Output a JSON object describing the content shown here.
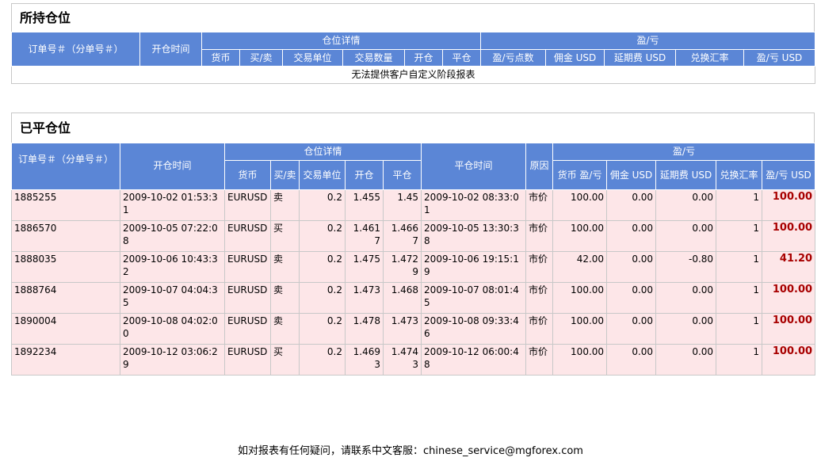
{
  "open_positions": {
    "title": "所持仓位",
    "headers": {
      "order": "订单号＃（分单号＃）",
      "open_time": "开仓时间",
      "details": "仓位详情",
      "pl": "盈/亏",
      "currency": "货币",
      "buy_sell": "买/卖",
      "unit": "交易单位",
      "qty": "交易数量",
      "open": "开仓",
      "close": "平仓",
      "pl_points": "盈/亏点数",
      "commission": "佣金 USD",
      "rollover": "延期费 USD",
      "fx_rate": "兑换汇率",
      "pl_usd": "盈/亏 USD"
    },
    "empty_message": "无法提供客户自定义阶段报表"
  },
  "closed_positions": {
    "title": "已平仓位",
    "headers": {
      "order": "订单号＃（分单号＃）",
      "open_time": "开仓时间",
      "details": "仓位详情",
      "close_time": "平仓时间",
      "reason": "原因",
      "pl": "盈/亏",
      "currency": "货币",
      "buy_sell": "买/卖",
      "unit": "交易单位",
      "open": "开仓",
      "close": "平仓",
      "pl_currency": "货币 盈/亏",
      "commission": "佣金 USD",
      "rollover": "延期费 USD",
      "fx_rate": "兑换汇率",
      "pl_usd": "盈/亏 USD"
    },
    "rows": [
      {
        "order": "1885255",
        "open_time": "2009-10-02 01:53:31",
        "currency": "EURUSD",
        "side": "卖",
        "unit": "0.2",
        "open": "1.455",
        "close": "1.45",
        "close_time": "2009-10-02 08:33:01",
        "reason": "市价",
        "pl_currency": "100.00",
        "commission": "0.00",
        "rollover": "0.00",
        "fx_rate": "1",
        "pl_usd": "100.00"
      },
      {
        "order": "1886570",
        "open_time": "2009-10-05 07:22:08",
        "currency": "EURUSD",
        "side": "买",
        "unit": "0.2",
        "open": "1.4617",
        "close": "1.4667",
        "close_time": "2009-10-05 13:30:38",
        "reason": "市价",
        "pl_currency": "100.00",
        "commission": "0.00",
        "rollover": "0.00",
        "fx_rate": "1",
        "pl_usd": "100.00"
      },
      {
        "order": "1888035",
        "open_time": "2009-10-06 10:43:32",
        "currency": "EURUSD",
        "side": "卖",
        "unit": "0.2",
        "open": "1.475",
        "close": "1.4729",
        "close_time": "2009-10-06 19:15:19",
        "reason": "市价",
        "pl_currency": "42.00",
        "commission": "0.00",
        "rollover": "-0.80",
        "fx_rate": "1",
        "pl_usd": "41.20"
      },
      {
        "order": "1888764",
        "open_time": "2009-10-07 04:04:35",
        "currency": "EURUSD",
        "side": "卖",
        "unit": "0.2",
        "open": "1.473",
        "close": "1.468",
        "close_time": "2009-10-07 08:01:45",
        "reason": "市价",
        "pl_currency": "100.00",
        "commission": "0.00",
        "rollover": "0.00",
        "fx_rate": "1",
        "pl_usd": "100.00"
      },
      {
        "order": "1890004",
        "open_time": "2009-10-08 04:02:00",
        "currency": "EURUSD",
        "side": "卖",
        "unit": "0.2",
        "open": "1.478",
        "close": "1.473",
        "close_time": "2009-10-08 09:33:46",
        "reason": "市价",
        "pl_currency": "100.00",
        "commission": "0.00",
        "rollover": "0.00",
        "fx_rate": "1",
        "pl_usd": "100.00"
      },
      {
        "order": "1892234",
        "open_time": "2009-10-12 03:06:29",
        "currency": "EURUSD",
        "side": "买",
        "unit": "0.2",
        "open": "1.4693",
        "close": "1.4743",
        "close_time": "2009-10-12 06:00:48",
        "reason": "市价",
        "pl_currency": "100.00",
        "commission": "0.00",
        "rollover": "0.00",
        "fx_rate": "1",
        "pl_usd": "100.00"
      }
    ]
  },
  "footer": {
    "text": "如对报表有任何疑问，请联系中文客服：chinese_service@mgforex.com"
  },
  "colors": {
    "header_bg": "#5b86d6",
    "row_bg": "#fde6e8",
    "pl_text": "#a80000"
  }
}
